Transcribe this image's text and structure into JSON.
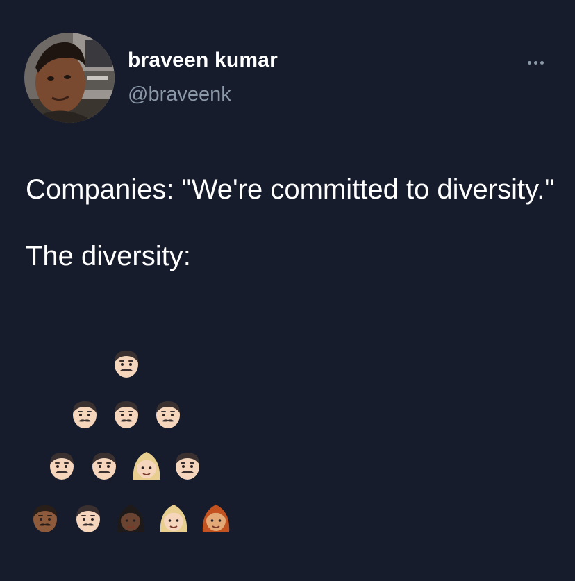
{
  "user": {
    "display_name": "braveen kumar",
    "handle": "@braveenk"
  },
  "tweet": {
    "line1": "Companies: \"We're committed to diversity.\"",
    "line2": "The diversity:"
  },
  "pyramid": {
    "rows": [
      [
        "man-light"
      ],
      [
        "man-light",
        "man-light",
        "man-light"
      ],
      [
        "man-light",
        "man-light",
        "woman-blonde",
        "man-light"
      ],
      [
        "man-dark",
        "man-light",
        "woman-dark",
        "woman-blonde",
        "woman-red"
      ]
    ]
  },
  "colors": {
    "background": "#161c2b",
    "text": "#ffffff",
    "secondary_text": "#8a98a8"
  },
  "icons": {
    "more": "more-options-icon"
  }
}
